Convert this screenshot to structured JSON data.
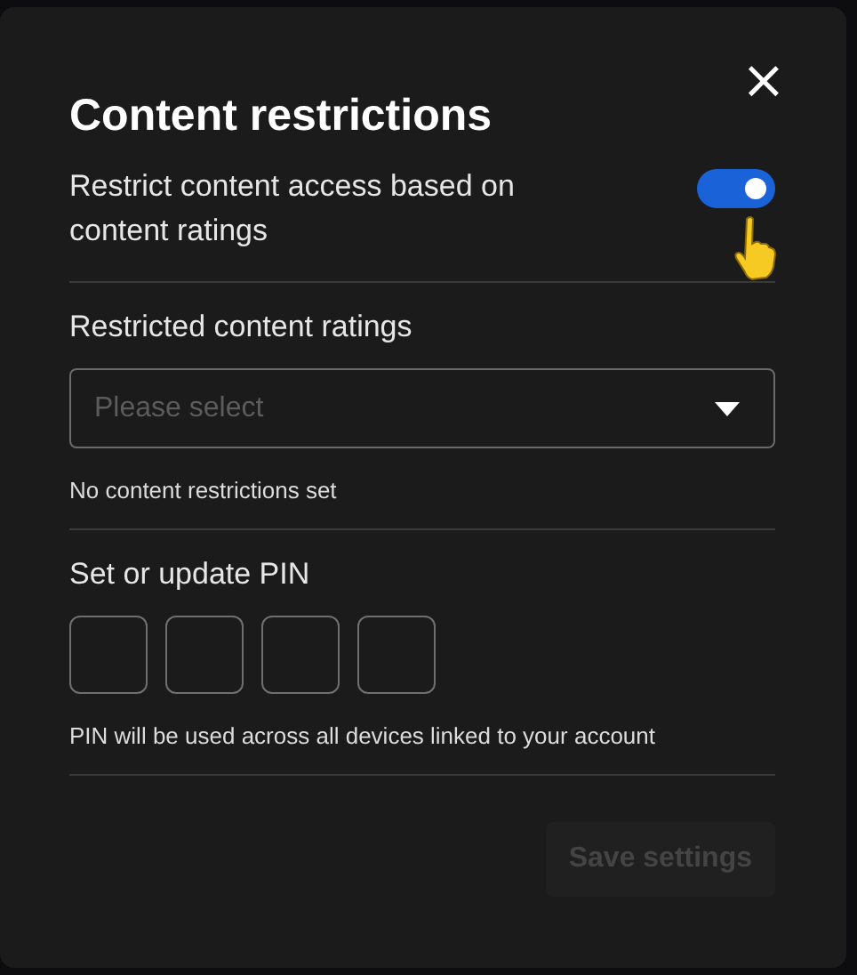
{
  "dialog": {
    "title": "Content restrictions",
    "close": "×"
  },
  "restrict_toggle": {
    "label": "Restrict content access based on content ratings",
    "on": true
  },
  "ratings": {
    "label": "Restricted content ratings",
    "placeholder": "Please select",
    "hint": "No content restrictions set"
  },
  "pin": {
    "label": "Set or update PIN",
    "fields": [
      {
        "kind": "digit"
      },
      {
        "kind": "digit"
      },
      {
        "kind": "digit"
      },
      {
        "kind": "digit"
      }
    ],
    "note": "PIN will be used across all devices linked to your account"
  },
  "save_button": {
    "label": "Save settings",
    "disabled": true
  }
}
